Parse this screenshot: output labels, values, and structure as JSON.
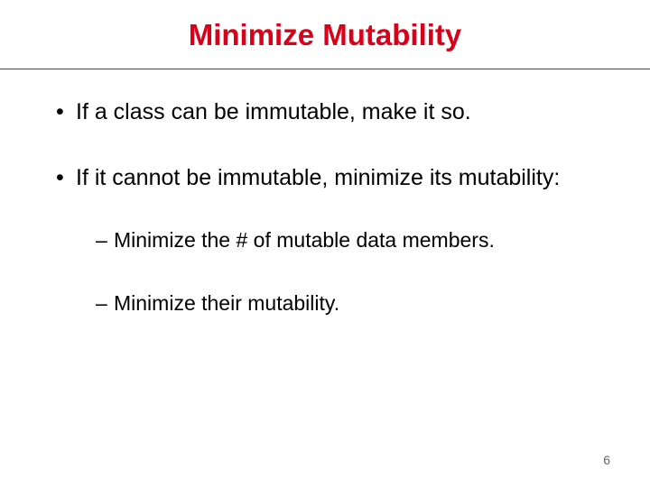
{
  "slide": {
    "title": "Minimize Mutability",
    "bullets": [
      {
        "text": "If a class can be immutable, make it so.",
        "children": []
      },
      {
        "text": "If it cannot be immutable, minimize its mutability:",
        "children": [
          {
            "text": "Minimize the # of mutable data members."
          },
          {
            "text": "Minimize their mutability."
          }
        ]
      }
    ],
    "page_number": "6"
  }
}
